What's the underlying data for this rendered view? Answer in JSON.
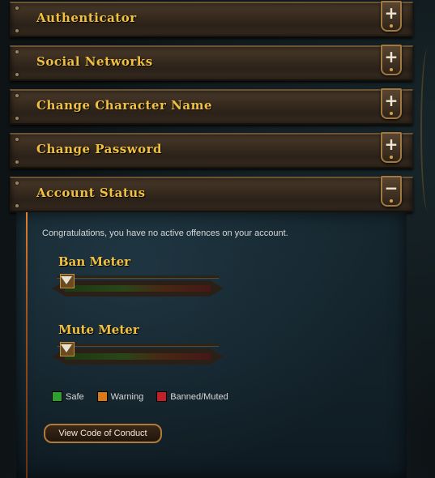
{
  "sections": [
    {
      "title": "Authenticator",
      "toggle": "+"
    },
    {
      "title": "Social Networks",
      "toggle": "+"
    },
    {
      "title": "Change Character Name",
      "toggle": "+"
    },
    {
      "title": "Change Password",
      "toggle": "+"
    },
    {
      "title": "Account Status",
      "toggle": "−"
    }
  ],
  "account_status": {
    "message": "Congratulations, you have no active offences on your account.",
    "ban_meter": {
      "label": "Ban Meter",
      "level": 0
    },
    "mute_meter": {
      "label": "Mute Meter",
      "level": 0
    },
    "legend": [
      {
        "label": "Safe",
        "color": "#2ea02e"
      },
      {
        "label": "Warning",
        "color": "#d87a1c"
      },
      {
        "label": "Banned/Muted",
        "color": "#c0202a"
      }
    ],
    "button": "View Code of Conduct"
  }
}
